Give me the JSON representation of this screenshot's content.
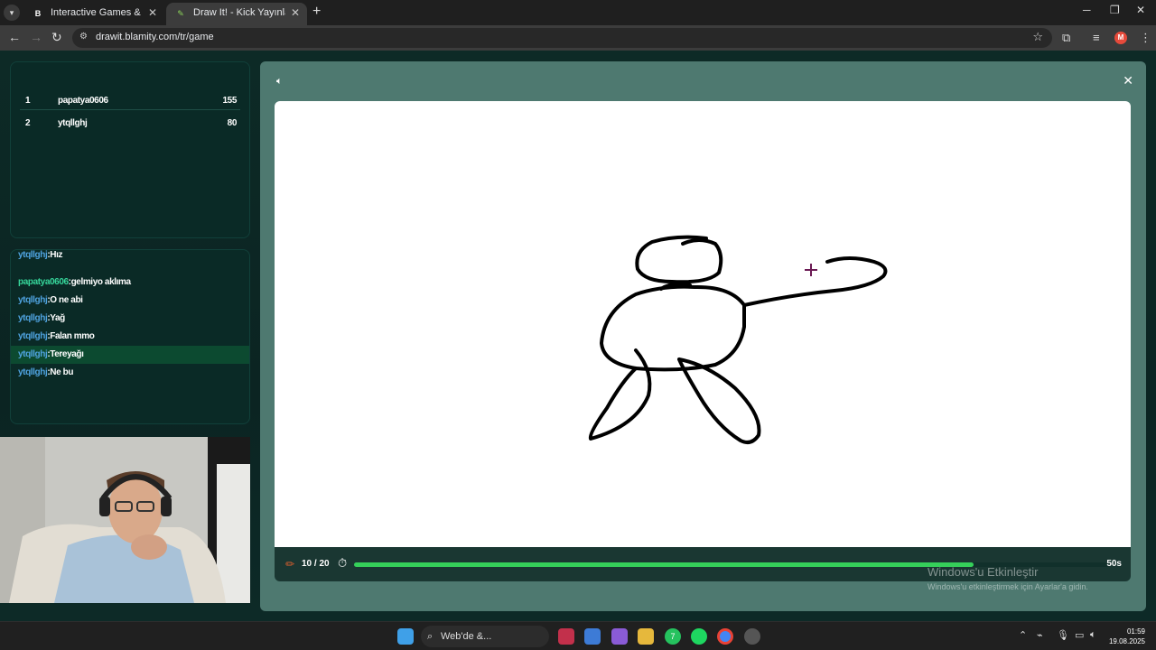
{
  "browser": {
    "tabs": [
      {
        "title": "Interactive Games & Streaming",
        "favicon": "B"
      },
      {
        "title": "Draw It! - Kick Yayınları İçin Çizim",
        "favicon": "✎"
      }
    ],
    "url": "drawit.blamity.com/tr/game",
    "profile_initial": "M"
  },
  "leaderboard": [
    {
      "rank": "1",
      "name": "papatya0606",
      "score": "155"
    },
    {
      "rank": "2",
      "name": "ytqllghj",
      "score": "80"
    }
  ],
  "chat": [
    {
      "user": "ytqllghj",
      "msg": ":Hız",
      "green": false
    },
    {
      "user": "papatya0606",
      "msg": ":gelmiyo aklıma",
      "green": true
    },
    {
      "user": "ytqllghj",
      "msg": ":O ne abi",
      "green": false
    },
    {
      "user": "ytqllghj",
      "msg": ":Yağ",
      "green": false
    },
    {
      "user": "ytqllghj",
      "msg": ":Falan mmo",
      "green": false
    },
    {
      "user": "ytqllghj",
      "msg": ":Tereyağı",
      "green": false,
      "highlight": true
    },
    {
      "user": "ytqllghj",
      "msg": ":Ne bu",
      "green": false
    }
  ],
  "game": {
    "round": "10 / 20",
    "time_left": "50s",
    "progress_fraction": 0.82
  },
  "windows_watermark": {
    "title": "Windows'u Etkinleştir",
    "subtitle": "Windows'u etkinleştirmek için Ayarlar'a gidin."
  },
  "taskbar": {
    "search_label": "Web'de &...",
    "time": "01:59",
    "date": "19.08.2025",
    "whatsapp_badge": "7"
  },
  "colors": {
    "accent_green": "#35d05a",
    "chat_user_blue": "#4fa3e0",
    "chat_user_green": "#36d69b"
  }
}
